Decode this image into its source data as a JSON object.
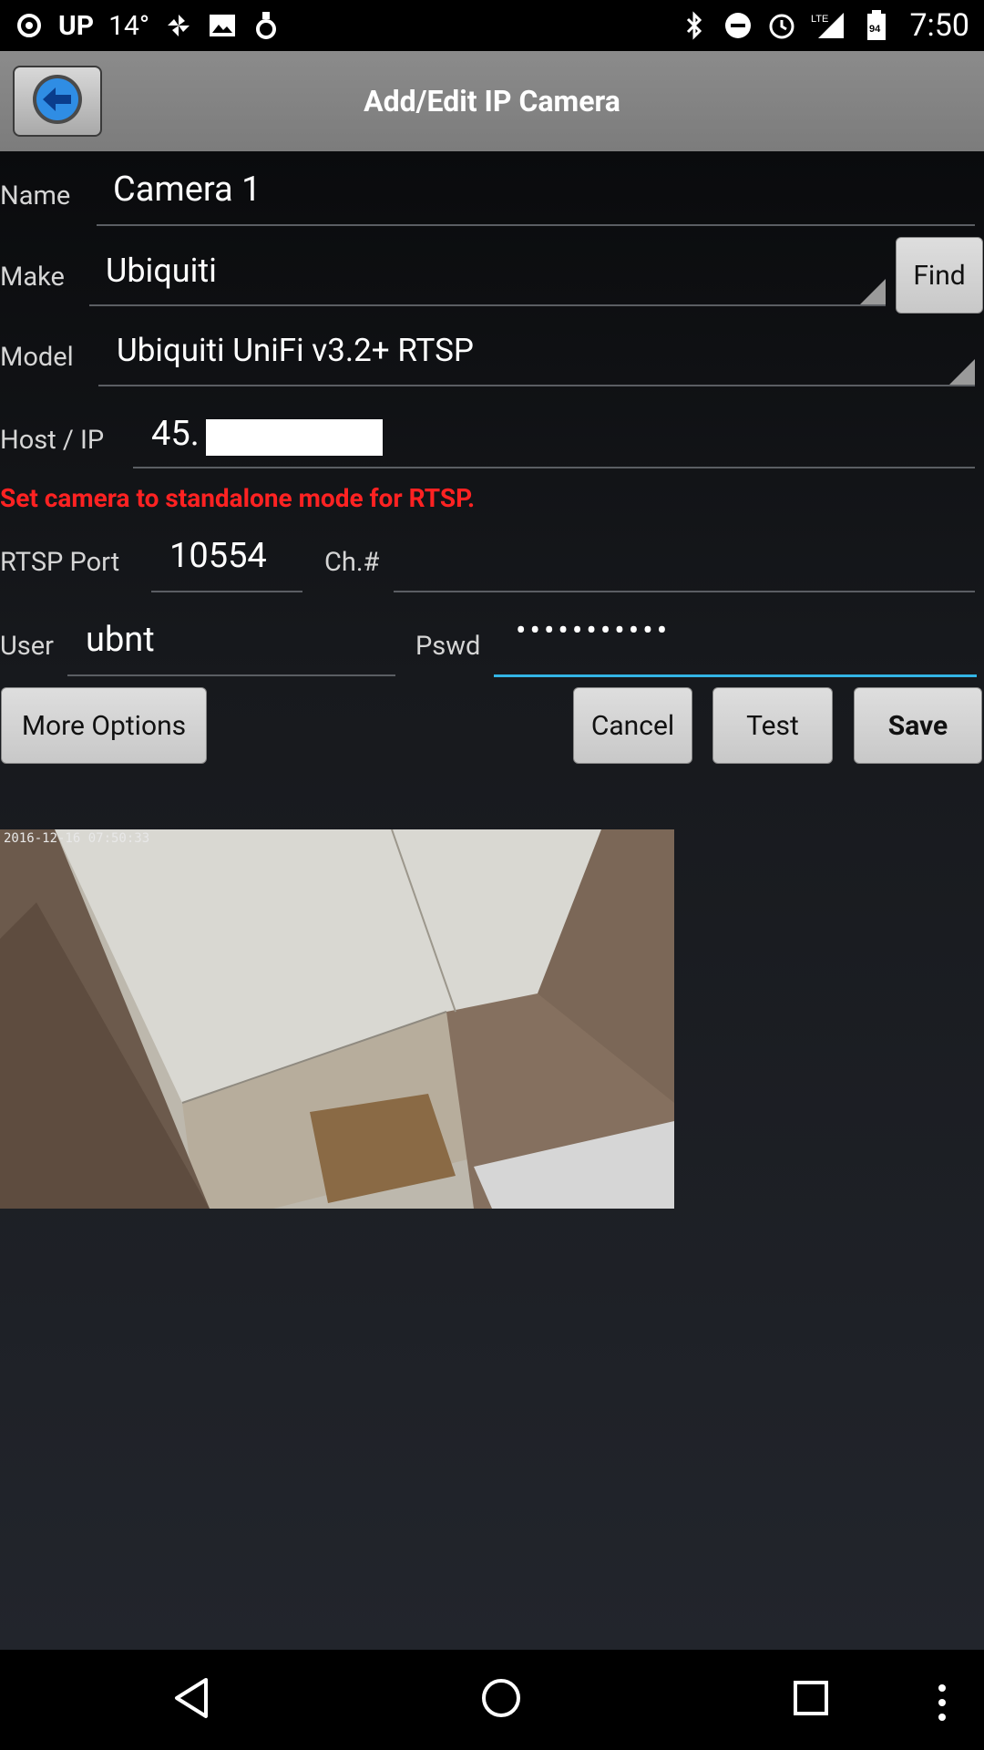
{
  "status_bar": {
    "carrier_text": "UP",
    "temperature": "14°",
    "battery": "94",
    "network": "LTE",
    "time": "7:50"
  },
  "app_bar": {
    "title": "Add/Edit IP Camera"
  },
  "form": {
    "name": {
      "label": "Name",
      "value": "Camera 1"
    },
    "make": {
      "label": "Make",
      "value": "Ubiquiti",
      "find_label": "Find"
    },
    "model": {
      "label": "Model",
      "value": "Ubiquiti UniFi v3.2+ RTSP"
    },
    "host": {
      "label": "Host / IP",
      "value": "45."
    },
    "warning": "Set camera to standalone mode for RTSP.",
    "rtsp_port": {
      "label": "RTSP Port",
      "value": "10554"
    },
    "channel": {
      "label": "Ch.#",
      "value": ""
    },
    "user": {
      "label": "User",
      "value": "ubnt"
    },
    "password": {
      "label": "Pswd",
      "value": "•••••••••••"
    }
  },
  "buttons": {
    "more_options": "More Options",
    "cancel": "Cancel",
    "test": "Test",
    "save": "Save"
  },
  "preview": {
    "timestamp": "2016-12-16 07:50:33"
  },
  "colors": {
    "warning": "#ff2222",
    "focus_underline": "#33b5e5",
    "appbar": "#808080"
  }
}
